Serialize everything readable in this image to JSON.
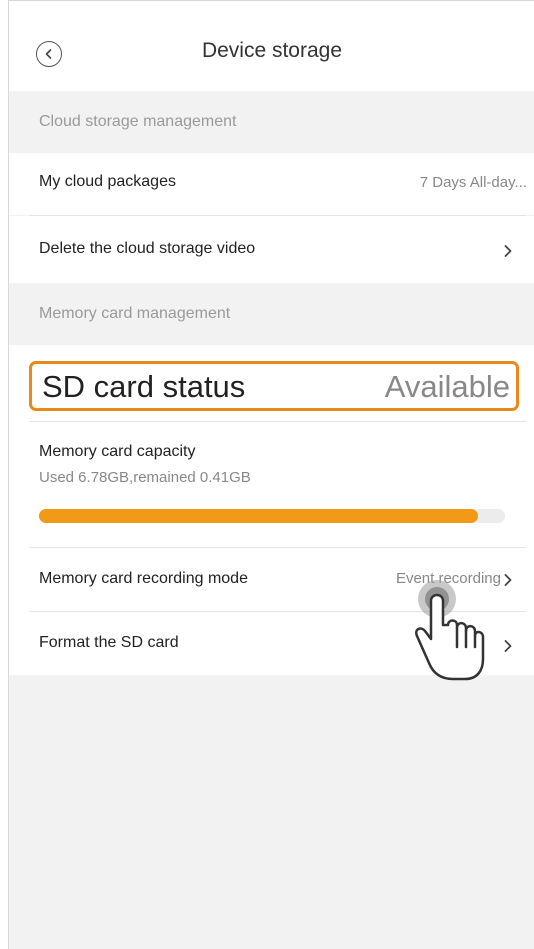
{
  "header": {
    "title": "Device storage"
  },
  "cloud": {
    "section_title": "Cloud storage management",
    "packages_label": "My cloud packages",
    "packages_value": "7 Days All-day...",
    "delete_label": "Delete the cloud storage video"
  },
  "memory": {
    "section_title": "Memory card management",
    "sd_status_label": "SD card status",
    "sd_status_value": "Available",
    "capacity_label": "Memory card capacity",
    "capacity_detail": "Used 6.78GB,remained 0.41GB",
    "capacity_used_fraction": 0.943,
    "recording_label": "Memory card recording mode",
    "recording_value": "Event recording",
    "format_label": "Format the SD card"
  },
  "colors": {
    "accent": "#f09a17",
    "highlight_border": "#e8891a"
  },
  "icons": {
    "back": "chevron-left-circle-icon",
    "chevron": "chevron-right-icon",
    "pointer": "hand-pointer-icon"
  }
}
